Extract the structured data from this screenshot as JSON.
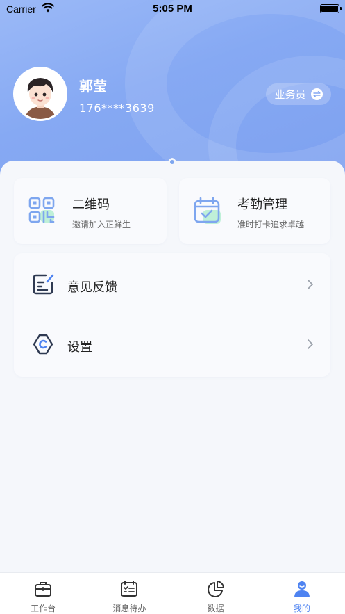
{
  "status_bar": {
    "carrier": "Carrier",
    "time": "5:05 PM"
  },
  "profile": {
    "name": "郭莹",
    "phone": "176****3639",
    "role": "业务员"
  },
  "cards": [
    {
      "title": "二维码",
      "subtitle": "邀请加入正鲜生",
      "icon": "qr-code-icon"
    },
    {
      "title": "考勤管理",
      "subtitle": "准时打卡追求卓越",
      "icon": "calendar-check-icon"
    }
  ],
  "menu": [
    {
      "label": "意见反馈",
      "icon": "feedback-edit-icon"
    },
    {
      "label": "设置",
      "icon": "settings-gear-icon"
    }
  ],
  "tabs": [
    {
      "label": "工作台",
      "icon": "briefcase-icon",
      "active": false
    },
    {
      "label": "消息待办",
      "icon": "todo-list-icon",
      "active": false
    },
    {
      "label": "数据",
      "icon": "pie-chart-icon",
      "active": false
    },
    {
      "label": "我的",
      "icon": "user-icon",
      "active": true
    }
  ],
  "colors": {
    "accent": "#4e83f1",
    "header": "#86a9f3",
    "icon_blue": "#7ea6ef",
    "icon_green": "#bff0d8"
  }
}
